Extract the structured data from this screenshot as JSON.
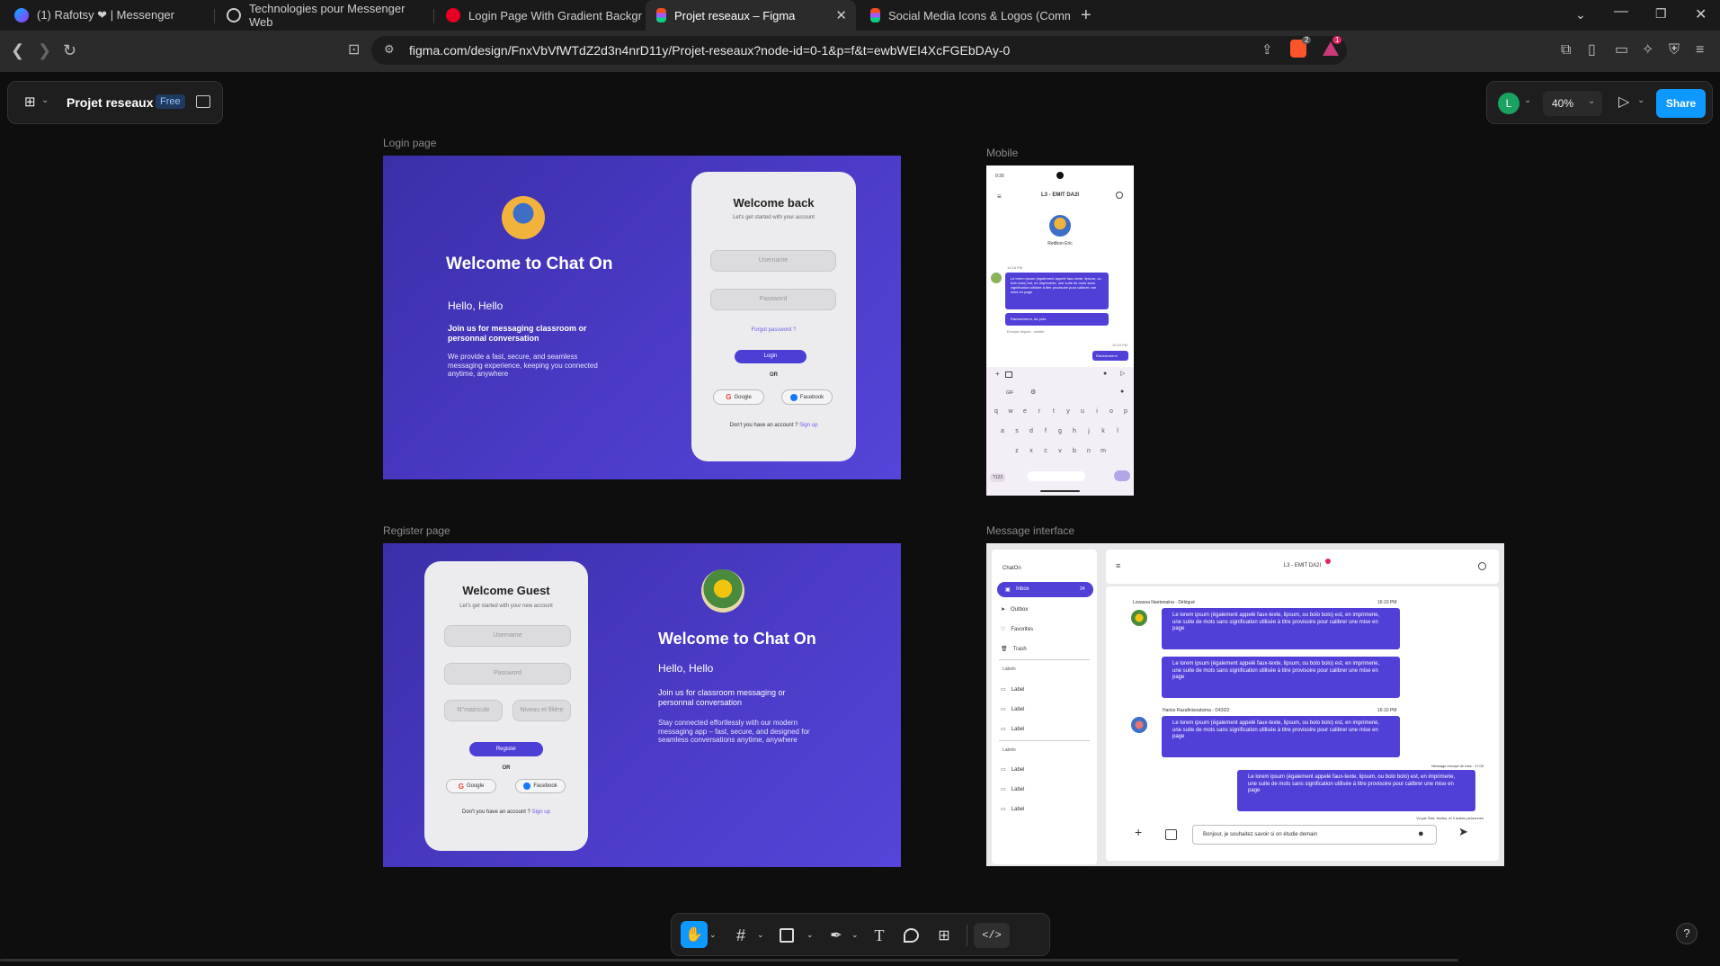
{
  "browser": {
    "tabs": [
      {
        "title": "(1) Rafotsy ❤ | Messenger"
      },
      {
        "title": "Technologies pour Messenger Web"
      },
      {
        "title": "Login Page With Gradient Backgrou"
      },
      {
        "title": "Projet reseaux – Figma"
      },
      {
        "title": "Social Media Icons & Logos (Comm"
      }
    ],
    "url": "figma.com/design/FnxVbVfWTdZ2d3n4nrD11y/Projet-reseaux?node-id=0-1&p=f&t=ewbWEI4XcFGEbDAy-0",
    "brave_badge": "2",
    "alert_badge": "1"
  },
  "figma": {
    "file_name": "Projet reseaux",
    "plan_badge": "Free",
    "avatar_letter": "L",
    "zoom": "40%",
    "share_label": "Share",
    "help": "?"
  },
  "frames": {
    "login_label": "Login page",
    "register_label": "Register page",
    "mobile_label": "Mobile",
    "message_label": "Message interface"
  },
  "login": {
    "title": "Welcome to Chat On",
    "hello": "Hello, Hello",
    "join": "Join us for messaging classroom or personnal conversation",
    "desc": "We provide a fast, secure, and seamless messaging experience, keeping you connected anytime, anywhere",
    "card_title": "Welcome back",
    "card_sub": "Let's get started with your account",
    "username": "Username",
    "password": "Password",
    "forgot": "Forgot password ?",
    "login_btn": "Login",
    "or": "OR",
    "google": "Google",
    "facebook": "Facebook",
    "no_account": "Don't you have an account ?",
    "signup": "Sign up"
  },
  "register": {
    "card_title": "Welcome Guest",
    "card_sub": "Let's get started with your new account",
    "username": "Username",
    "password": "Password",
    "matricule": "N°matricule",
    "niveau": "Niveau et filière",
    "register_btn": "Register",
    "or": "OR",
    "google": "Google",
    "facebook": "Facebook",
    "no_account": "Don't you have an account ?",
    "signup": "Sign up",
    "title": "Welcome to Chat On",
    "hello": "Hello, Hello",
    "join": "Join us for classroom messaging or personnal conversation",
    "desc": "Stay connected effortlessly with our modern messaging app – fast, secure, and designed for seamless conversations anytime, anywhere"
  },
  "mobile": {
    "time": "9:30",
    "header": "L3 - EMIT DA2I",
    "contact": "Redbon Eric",
    "time1": "10:18 PM",
    "msg1": "Le lorem ipsum (également appelé faux-texte, lipsum, ou bolo bolo) est, en imprimerie, une suite de mots sans signification utilisée à titre provisoire pour calibrer une mise en page",
    "msg2": "Rarizanmenn, de prés",
    "seen": "Envoyé depuis : mobile",
    "time2": "10:19 PM",
    "reply": "Rarizanmenn",
    "kb_row1": [
      "q",
      "w",
      "e",
      "r",
      "t",
      "y",
      "u",
      "i",
      "o",
      "p"
    ],
    "kb_row2": [
      "a",
      "s",
      "d",
      "f",
      "g",
      "h",
      "j",
      "k",
      "l"
    ],
    "kb_row3": [
      "z",
      "x",
      "c",
      "v",
      "b",
      "n",
      "m"
    ],
    "kb_num": "?123",
    "kb_gif": "GIF"
  },
  "messages": {
    "app_name": "ChatOn",
    "nav": [
      {
        "label": "Inbox",
        "count": "24"
      },
      {
        "label": "Outbox"
      },
      {
        "label": "Favorites"
      },
      {
        "label": "Trash"
      }
    ],
    "labels_heading_1": "Labels",
    "labels_1": [
      "Label",
      "Label",
      "Label"
    ],
    "labels_heading_2": "Labels",
    "labels_2": [
      "Label",
      "Label",
      "Label"
    ],
    "header": "L3 - EMIT DA2I",
    "sender1": "Lovasoa Nantenaina - Délégué",
    "time1": "16:10 PM",
    "sender2": "Hariso Razafinisoatsima - D43I22",
    "time2": "16:10 PM",
    "lorem": "Le lorem ipsum (également appelé faux-texte, lipsum, ou bolo bolo) est, en imprimerie, une suite de mots sans signification utilisée à titre provisoire pour calibrer une mise en page",
    "sent_meta": "Message envoyé de mas : 17:05",
    "seen_by": "Vu par Rod, Hariso, et 3 autres personnes",
    "input_text": "Bonjour, je souhaitez savoir si on étudie demain"
  },
  "tools": [
    "hand-tool",
    "frame-tool",
    "shape-tool",
    "pen-tool",
    "text-tool",
    "comment-tool",
    "actions-tool",
    "dev-mode"
  ]
}
